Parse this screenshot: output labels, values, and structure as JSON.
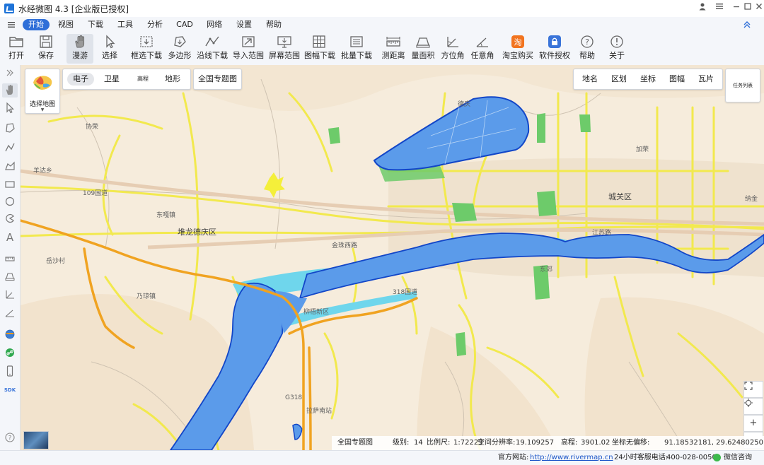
{
  "app": {
    "title": "水经微图 4.3 [企业版已授权]"
  },
  "window_controls": [
    "user-icon",
    "menu-icon",
    "minimize-icon",
    "maximize-icon",
    "close-icon"
  ],
  "menu": {
    "items": [
      "开始",
      "视图",
      "下载",
      "工具",
      "分析",
      "CAD",
      "网络",
      "设置",
      "帮助"
    ],
    "active": "开始"
  },
  "toolbar": {
    "items": [
      {
        "label": "打开",
        "icon": "folder-icon"
      },
      {
        "label": "保存",
        "icon": "save-icon"
      },
      {
        "label": "漫游",
        "icon": "hand-icon",
        "active": true
      },
      {
        "label": "选择",
        "icon": "pointer-icon"
      },
      {
        "label": "框选下载",
        "icon": "box-download-icon"
      },
      {
        "label": "多边形",
        "icon": "polygon-icon"
      },
      {
        "label": "沿线下载",
        "icon": "line-download-icon"
      },
      {
        "label": "导入范围",
        "icon": "import-range-icon"
      },
      {
        "label": "屏幕范围",
        "icon": "screen-range-icon"
      },
      {
        "label": "图幅下载",
        "icon": "sheet-download-icon"
      },
      {
        "label": "批量下载",
        "icon": "batch-download-icon"
      },
      {
        "label": "测距离",
        "icon": "ruler-icon"
      },
      {
        "label": "量面积",
        "icon": "area-icon"
      },
      {
        "label": "方位角",
        "icon": "azimuth-icon"
      },
      {
        "label": "任意角",
        "icon": "angle-icon"
      },
      {
        "label": "淘宝购买",
        "icon": "taobao-icon"
      },
      {
        "label": "软件授权",
        "icon": "license-icon"
      },
      {
        "label": "帮助",
        "icon": "help-icon"
      },
      {
        "label": "关于",
        "icon": "info-icon"
      }
    ]
  },
  "map": {
    "select_map_label": "选择地图",
    "types": [
      "电子",
      "卫星",
      "高程",
      "地形"
    ],
    "active_type": "电子",
    "thematic_button": "全国专题图",
    "layers": [
      "地名",
      "区划",
      "坐标",
      "图幅",
      "瓦片"
    ],
    "task_list": "任务列表",
    "labels": [
      {
        "text": "城关区",
        "big": true
      },
      {
        "text": "堆龙德庆区",
        "big": true
      },
      {
        "text": "东嘎镇"
      },
      {
        "text": "金珠西路"
      },
      {
        "text": "柳梧新区"
      },
      {
        "text": "拉萨南站"
      },
      {
        "text": "江苏路"
      },
      {
        "text": "乃琼镇"
      },
      {
        "text": "加荣"
      },
      {
        "text": "109国道"
      },
      {
        "text": "318国道"
      },
      {
        "text": "G318"
      },
      {
        "text": "协荣"
      },
      {
        "text": "德庆"
      },
      {
        "text": "岳沙村"
      },
      {
        "text": "羊达乡"
      },
      {
        "text": "纳金"
      },
      {
        "text": "东郊"
      }
    ]
  },
  "status": {
    "thematic": "全国专题图",
    "level_label": "级别:",
    "level": "14",
    "scale_label": "比例尺:",
    "scale": "1:72223",
    "resolution_label": "空间分辨率:",
    "resolution": "19.109257",
    "elevation_label": "高程:",
    "elevation": "3901.02",
    "coord_label": "坐标无偏移:",
    "coords": "91.18532181, 29.62480250"
  },
  "bottom": {
    "website_label": "官方网站:",
    "website": "http://www.rivermap.cn",
    "hotline_label": "24小时客服电话:",
    "hotline": "400-028-0050",
    "wechat": "微信咨询"
  },
  "sidebar_icons": [
    "expand-icon",
    "hand-icon",
    "pointer-icon",
    "polygon-draw-icon",
    "polyline-icon",
    "area-draw-icon",
    "rectangle-icon",
    "circle-icon",
    "sector-icon",
    "text-icon",
    "ruler-icon",
    "area-measure-icon",
    "azimuth-icon",
    "angle-icon",
    "globe-icon",
    "link-icon",
    "mobile-icon",
    "sdk-icon",
    "help-icon"
  ],
  "colors": {
    "accent": "#2f6fd8",
    "water": "#5b9bea",
    "river_outline": "#1246c8",
    "shallow_water": "#6fd6ec",
    "road": "#f2e94e",
    "highway": "#f0a321",
    "park": "#6dcb6a",
    "land": "#f6ecdc"
  }
}
